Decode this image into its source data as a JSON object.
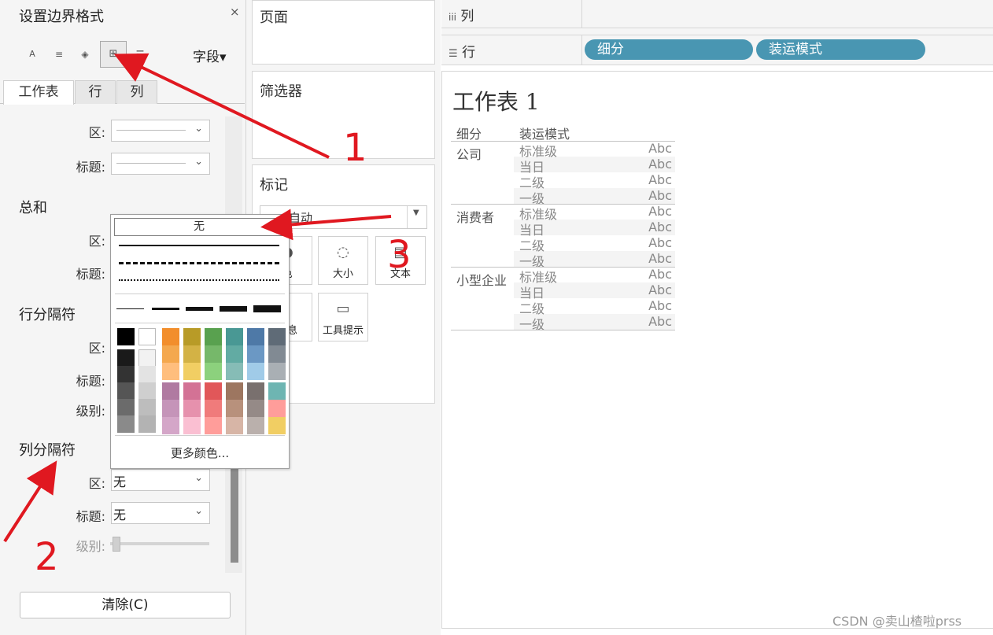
{
  "format_panel": {
    "title": "设置边界格式",
    "close": "×",
    "fields_dropdown": "字段▾",
    "tools": {
      "font": "A",
      "align": "≡",
      "shading": "◈",
      "borders": "⊞",
      "lines": "☰"
    },
    "tabs": {
      "sheet": "工作表",
      "rows": "行",
      "columns": "列"
    },
    "section_top": {
      "pane_label": "区:",
      "header_label": "标题:"
    },
    "grand_total": {
      "title": "总和",
      "pane_label": "区:",
      "header_label": "标题:"
    },
    "row_divider": {
      "title": "行分隔符",
      "pane_label": "区:",
      "header_label": "标题:",
      "level_label": "级别:"
    },
    "col_divider": {
      "title": "列分隔符",
      "pane_label": "区:",
      "pane_value": "无",
      "header_label": "标题:",
      "header_value": "无",
      "level_label": "级别:"
    },
    "clear_button": "清除(C)"
  },
  "cards": {
    "pages": "页面",
    "filters": "筛选器",
    "marks": {
      "title": "标记",
      "type": "自动",
      "buttons": [
        {
          "label": "色",
          "icon": "color-icon"
        },
        {
          "label": "大小",
          "icon": "size-icon"
        },
        {
          "label": "文本",
          "icon": "text-icon"
        },
        {
          "label": "信息",
          "icon": "detail-icon"
        },
        {
          "label": "工具提示",
          "icon": "tooltip-icon"
        }
      ]
    }
  },
  "shelves": {
    "columns_label": "列",
    "rows_label": "行",
    "row_pills": [
      "细分",
      "装运模式"
    ]
  },
  "view": {
    "sheet_title": "工作表 1",
    "headers": {
      "segment": "细分",
      "ship_mode": "装运模式"
    },
    "groups": [
      {
        "segment": "公司",
        "rows": [
          "标准级",
          "当日",
          "二级",
          "一级"
        ]
      },
      {
        "segment": "消费者",
        "rows": [
          "标准级",
          "当日",
          "二级",
          "一级"
        ]
      },
      {
        "segment": "小型企业",
        "rows": [
          "标准级",
          "当日",
          "二级",
          "一级"
        ]
      }
    ],
    "cell_value": "Abc"
  },
  "border_popup": {
    "none_option": "无",
    "line_styles": [
      "solid",
      "dashed",
      "dotted"
    ],
    "weights": [
      1,
      2,
      3,
      5,
      6
    ],
    "more_colors": "更多颜色...",
    "colors": {
      "basic": [
        "#000000",
        "#ffffff"
      ],
      "grays_dark": [
        "#1a1a1a",
        "#333333",
        "#555555",
        "#6b6b6b",
        "#8a8a8a"
      ],
      "grays_light": [
        "#f2f2f2",
        "#e3e3e3",
        "#cfcfcf",
        "#bdbdbd",
        "#b3b3b3"
      ],
      "top_palette": [
        [
          "#f28e2c",
          "#f4a84e",
          "#ffbe7d"
        ],
        [
          "#b89b27",
          "#d3b245",
          "#f1ce63"
        ],
        [
          "#59a14f",
          "#76b86a",
          "#8cd17d"
        ],
        [
          "#499894",
          "#62aba3",
          "#86bcb6"
        ],
        [
          "#4e79a7",
          "#6b98c4",
          "#a0cbe8"
        ],
        [
          "#5f6b77",
          "#818a93",
          "#a9afb4"
        ]
      ],
      "bottom_palette": [
        [
          "#b07aa1",
          "#c594b9",
          "#d4a6c8"
        ],
        [
          "#d37295",
          "#e691ad",
          "#fabfd2"
        ],
        [
          "#e15759",
          "#f07b7b",
          "#ff9d9a"
        ],
        [
          "#9d7660",
          "#b8917c",
          "#d7b5a6"
        ],
        [
          "#79706e",
          "#958a87",
          "#bab0ac"
        ],
        [
          "#6eb5b2",
          "#ff9d9a",
          "#f1ce63"
        ]
      ]
    }
  },
  "annotations": {
    "n1": "1",
    "n2": "2",
    "n3": "3",
    "color": "#e01820"
  },
  "watermark": "CSDN @卖山楂啦prss"
}
